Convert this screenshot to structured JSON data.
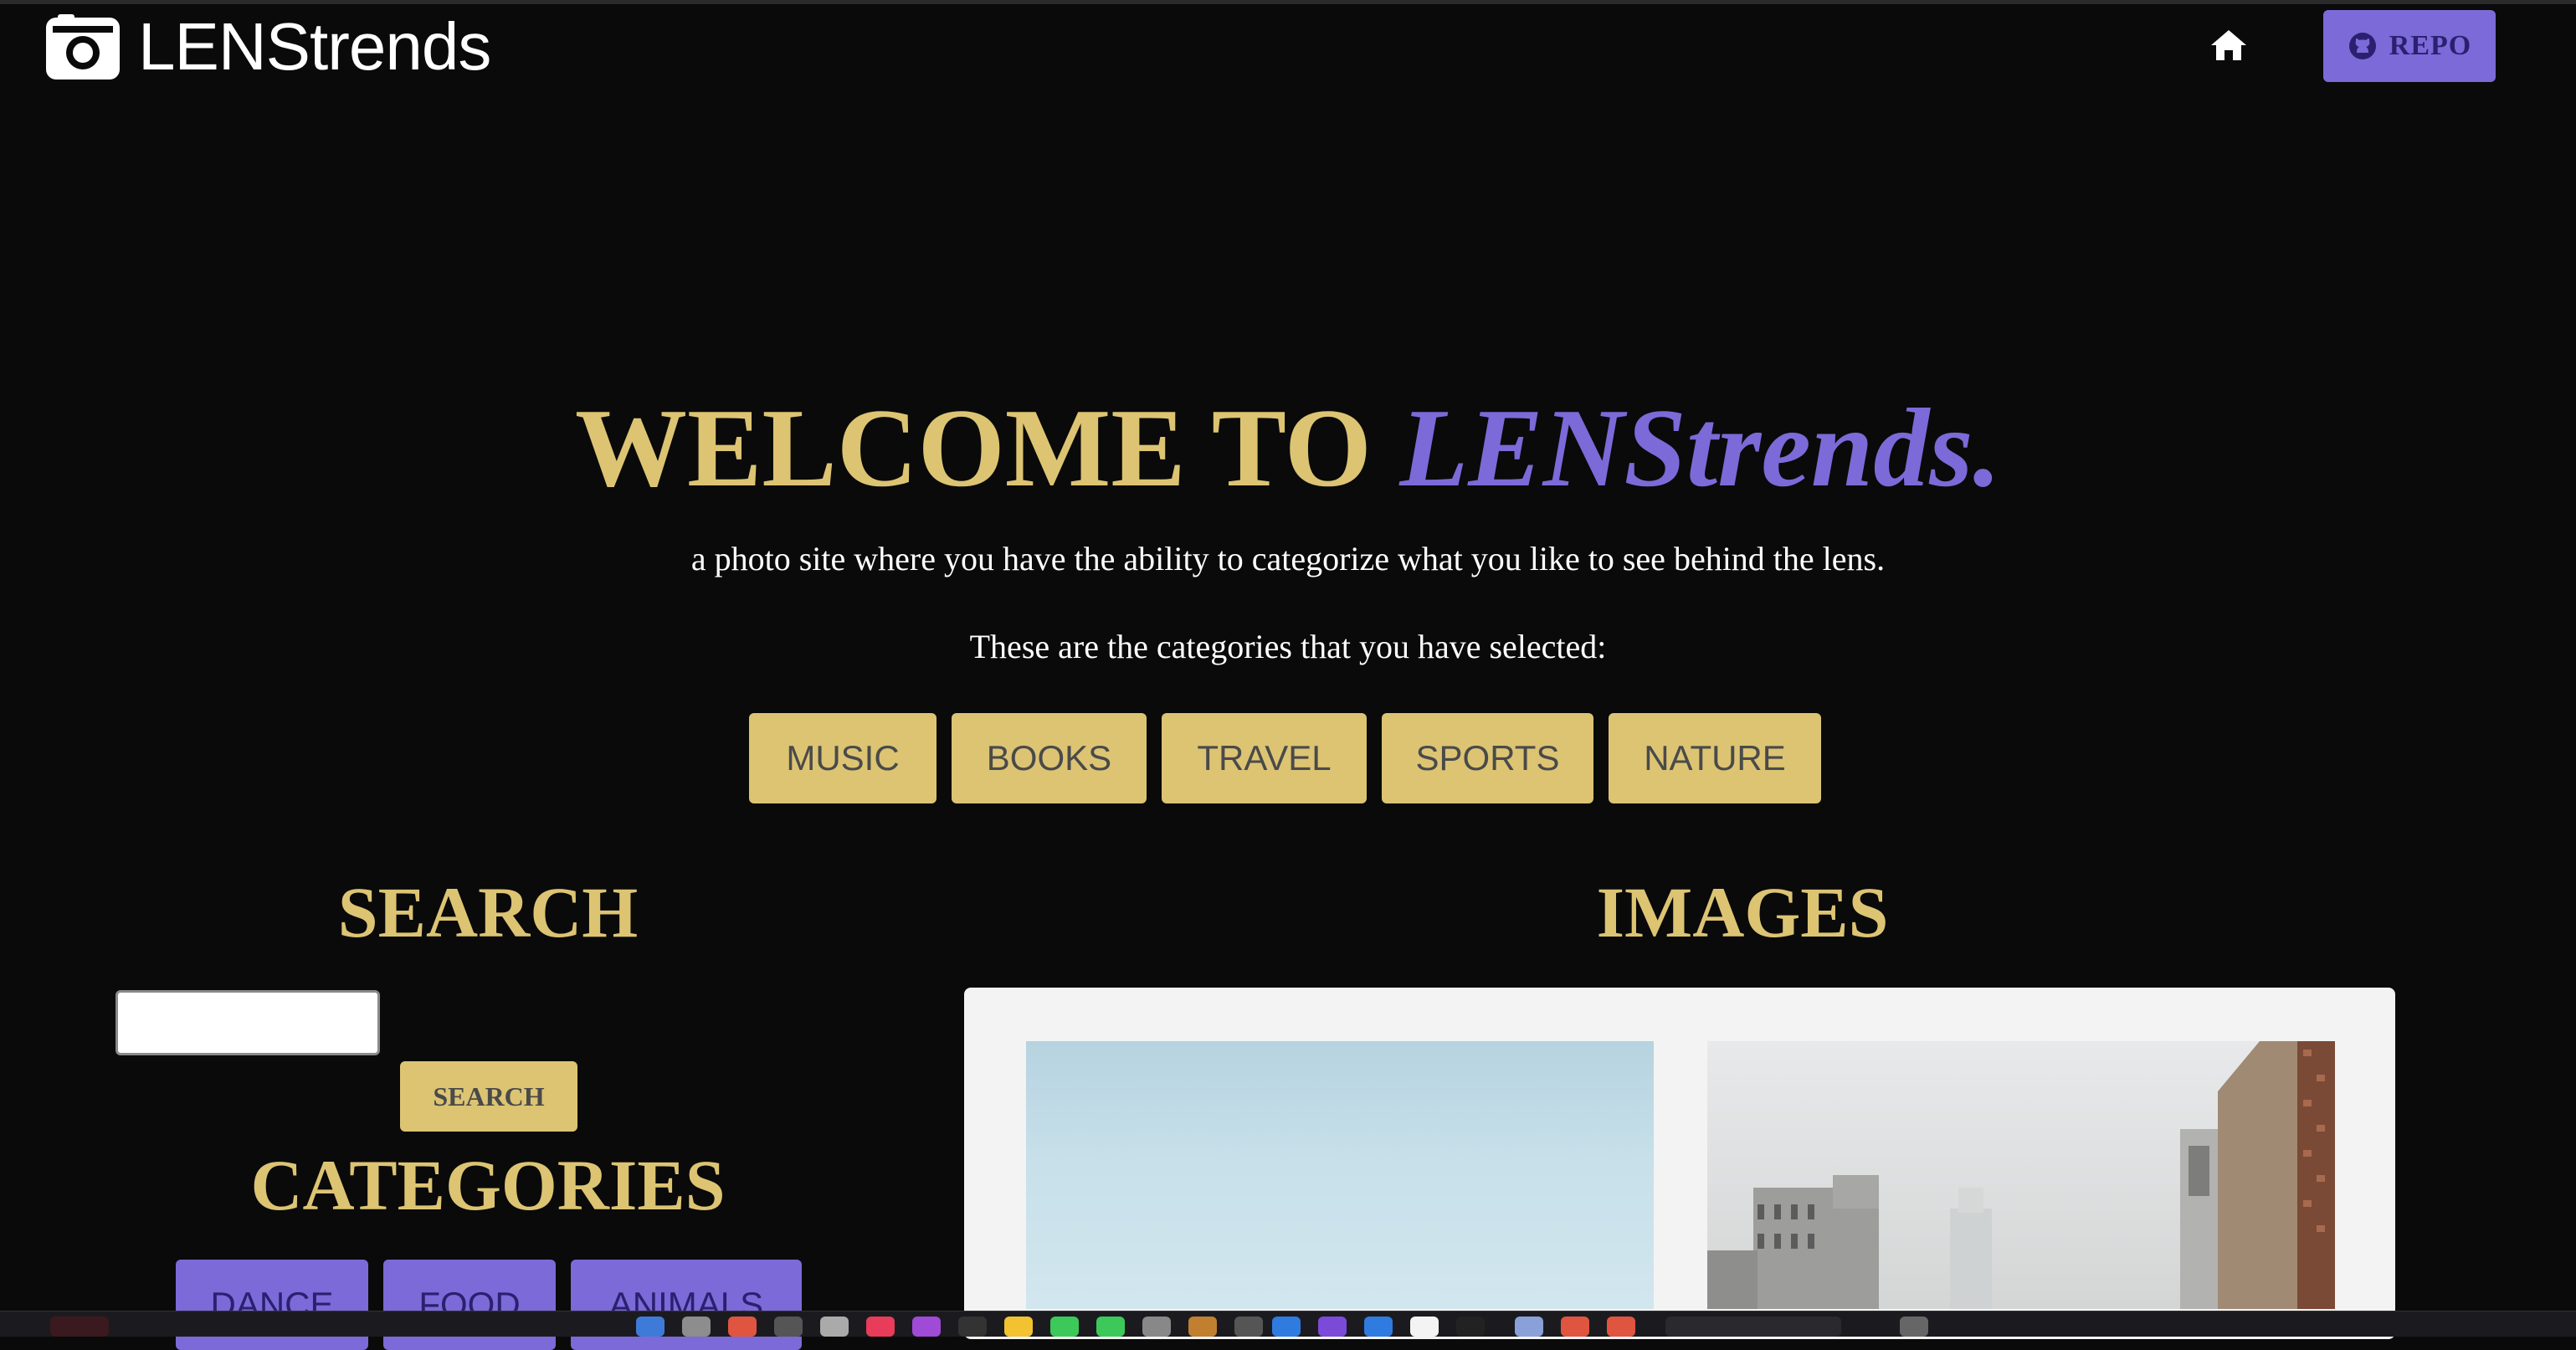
{
  "header": {
    "brand": "LENStrends",
    "repo_label": "REPO"
  },
  "hero": {
    "title_prefix": "WELCOME TO ",
    "title_accent": "LENStrends.",
    "subtitle": "a photo site where you have the ability to categorize what you like to see behind the lens.",
    "selected_intro": "These are the categories that you have selected:"
  },
  "selected_categories": [
    "MUSIC",
    "BOOKS",
    "TRAVEL",
    "SPORTS",
    "NATURE"
  ],
  "search": {
    "heading": "SEARCH",
    "input_value": "",
    "button_label": "SEARCH"
  },
  "categories": {
    "heading": "CATEGORIES",
    "items": [
      "DANCE",
      "FOOD",
      "ANIMALS"
    ]
  },
  "images": {
    "heading": "IMAGES"
  },
  "colors": {
    "background": "#0a0a0a",
    "gold": "#dcc473",
    "purple": "#7b6ad8",
    "white": "#ffffff"
  },
  "icons": [
    "camera-icon",
    "home-icon",
    "github-icon"
  ]
}
